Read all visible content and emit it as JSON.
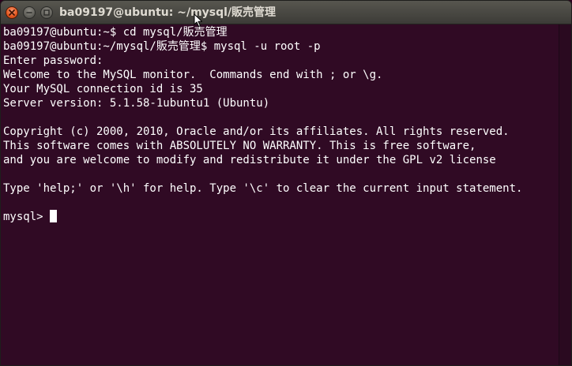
{
  "window": {
    "title": "ba09197@ubuntu: ~/mysql/販売管理",
    "buttons": {
      "close_icon": "close-icon",
      "minimize_icon": "minimize-icon",
      "maximize_icon": "maximize-icon"
    }
  },
  "terminal": {
    "lines": [
      "ba09197@ubuntu:~$ cd mysql/販売管理",
      "ba09197@ubuntu:~/mysql/販売管理$ mysql -u root -p",
      "Enter password:",
      "Welcome to the MySQL monitor.  Commands end with ; or \\g.",
      "Your MySQL connection id is 35",
      "Server version: 5.1.58-1ubuntu1 (Ubuntu)",
      "",
      "Copyright (c) 2000, 2010, Oracle and/or its affiliates. All rights reserved.",
      "This software comes with ABSOLUTELY NO WARRANTY. This is free software,",
      "and you are welcome to modify and redistribute it under the GPL v2 license",
      "",
      "Type 'help;' or '\\h' for help. Type '\\c' to clear the current input statement.",
      ""
    ],
    "prompt": "mysql> "
  },
  "colors": {
    "background": "#300a24",
    "text": "#ffffff",
    "titlebar": "#3c3b37",
    "close_button": "#e4571f"
  }
}
